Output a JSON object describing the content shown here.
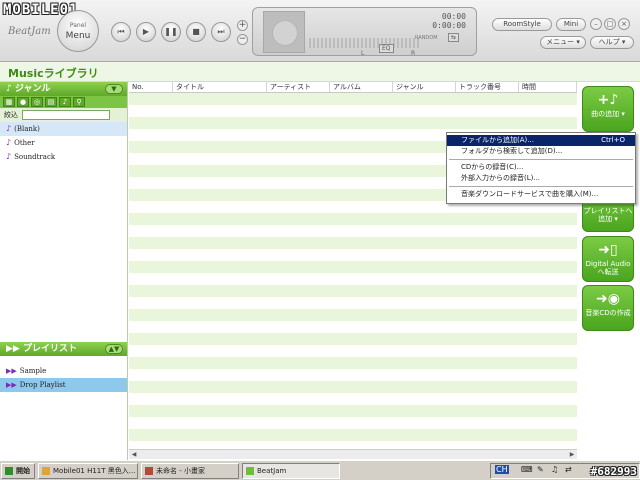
{
  "watermark": "MOBILE01",
  "watermark_id": "#682993",
  "player": {
    "logo": "BeatJam",
    "panel_menu_small": "Panel",
    "panel_menu_big": "Menu",
    "time_top": "00:00",
    "time_bottom": "0:00:00",
    "random_label": "RANDOM",
    "eq_label": "EQ",
    "left_label": "L",
    "right_label": "R",
    "roomstyle": "RoomStyle",
    "mini": "Mini",
    "menu": "メニュー",
    "help": "ヘルプ"
  },
  "library_title": "Musicライブラリ",
  "genre": {
    "title": "ジャンル",
    "filter_label": "絞込",
    "filter_value": "",
    "items": [
      "(Blank)",
      "Other",
      "Soundtrack"
    ]
  },
  "playlist": {
    "title": "プレイリスト",
    "items": [
      "Sample",
      "Drop Playlist"
    ]
  },
  "table": {
    "columns": [
      "No.",
      "タイトル",
      "アーティスト",
      "アルバム",
      "ジャンル",
      "トラック番号",
      "時間"
    ]
  },
  "right_buttons": {
    "add_song": "曲の追加",
    "add_playlist_1": "プレイリストへ",
    "add_playlist_2": "追加",
    "digital_audio_1": "Digital Audio",
    "digital_audio_2": "へ転送",
    "cd_create": "音楽CDの作成"
  },
  "context_menu": {
    "items": [
      {
        "label": "ファイルから追加(A)...",
        "shortcut": "Ctrl+O"
      },
      {
        "label": "フォルダから検索して追加(D)...",
        "shortcut": ""
      },
      {
        "label": "CDからの録音(C)...",
        "shortcut": ""
      },
      {
        "label": "外部入力からの録音(L)...",
        "shortcut": ""
      },
      {
        "label": "音楽ダウンロードサービスで曲を購入(M)...",
        "shortcut": ""
      }
    ]
  },
  "taskbar": {
    "start": "開始",
    "tasks": [
      "Mobile01 H11T 黑色入...",
      "未命名 - 小畫家",
      "BeatJam"
    ],
    "tray_lang": "CH"
  },
  "colors": {
    "accent_green": "#5fa829",
    "row_green": "#eaf6dc",
    "menu_highlight": "#0a246a"
  }
}
